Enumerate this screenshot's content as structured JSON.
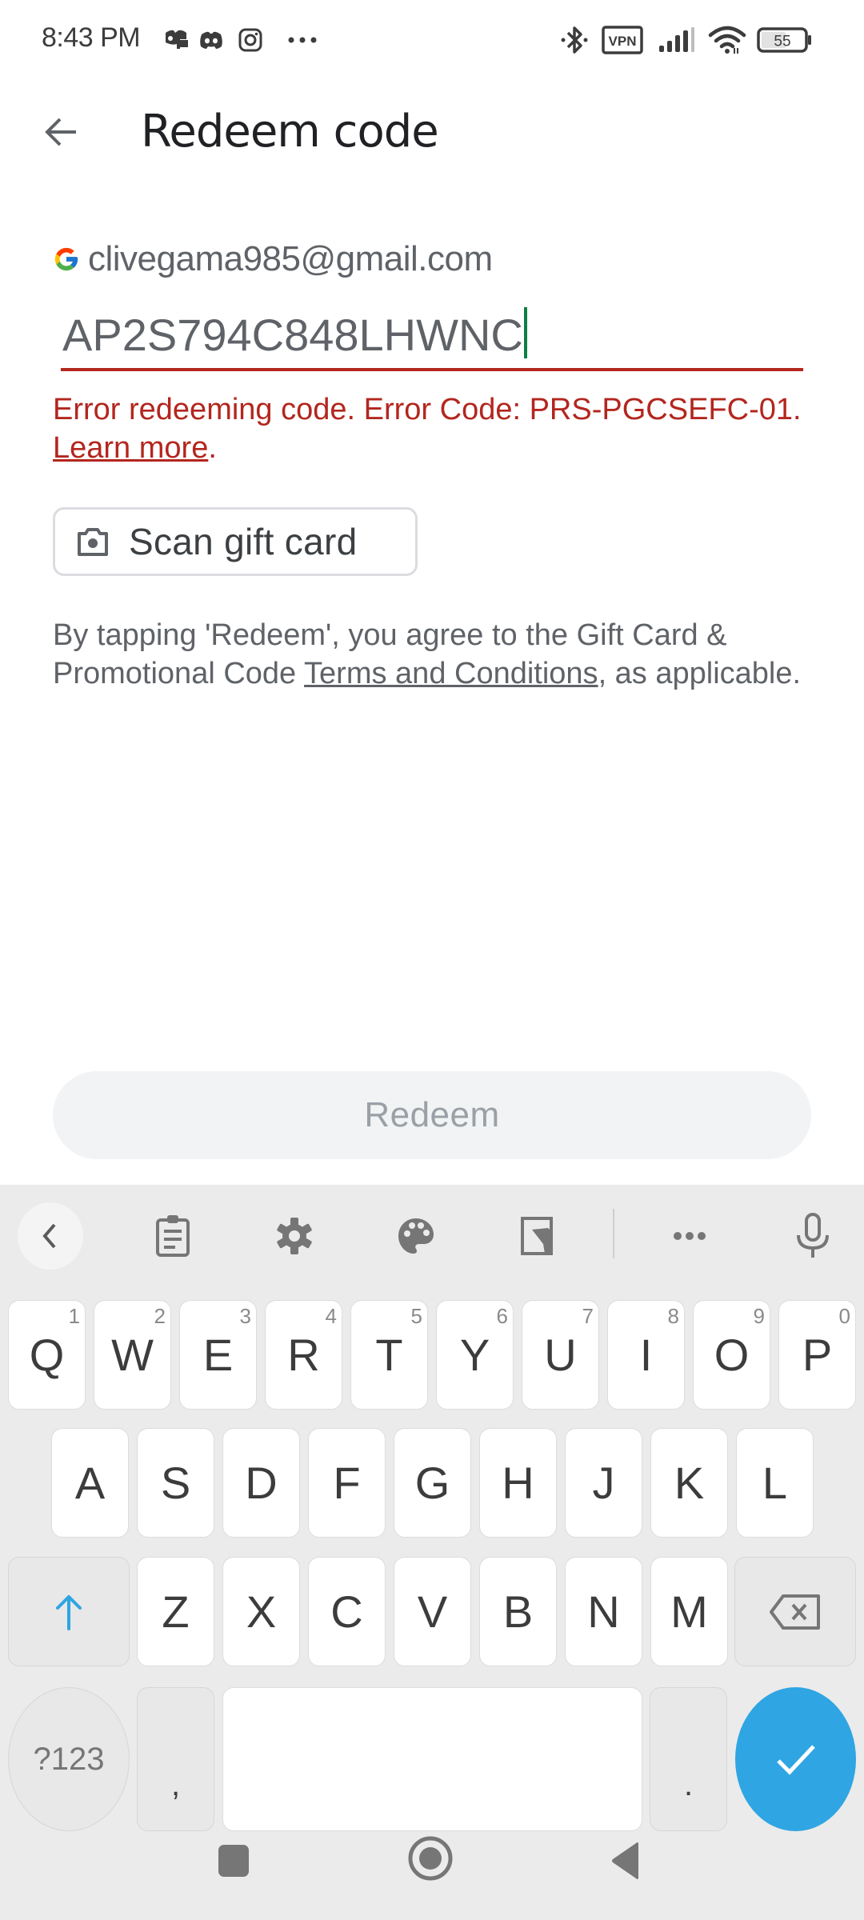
{
  "status_bar": {
    "time": "8:43 PM",
    "left_icons": [
      "discord-chat-icon",
      "discord-icon",
      "instagram-icon",
      "more-notifications-icon"
    ],
    "right_icons": [
      "bluetooth-icon",
      "vpn-icon",
      "signal-icon",
      "wifi-icon",
      "battery-icon"
    ],
    "vpn_label": "VPN",
    "battery_level": "55"
  },
  "app_bar": {
    "back_icon": "arrow-back-icon",
    "title": "Redeem code"
  },
  "account": {
    "icon": "google-logo-icon",
    "email": "clivegama985@gmail.com"
  },
  "code_field": {
    "value": "AP2S794C848LHWNC",
    "error_prefix": "Error redeeming code. Error Code: PRS-PGCSEFC-01. ",
    "error_link": "Learn more",
    "error_suffix": ".",
    "error_color": "#b3261e"
  },
  "scan_button": {
    "icon": "camera-icon",
    "label": "Scan gift card"
  },
  "terms": {
    "prefix": "By tapping 'Redeem', you agree to the Gift Card & Promotional Code ",
    "link": "Terms and Conditions",
    "suffix": ", as applicable."
  },
  "redeem_button": {
    "label": "Redeem",
    "enabled": false
  },
  "keyboard": {
    "toolbar": [
      "collapse-icon",
      "clipboard-icon",
      "settings-icon",
      "theme-palette-icon",
      "one-handed-icon",
      "more-icon",
      "microphone-icon"
    ],
    "row1": [
      {
        "key": "Q",
        "hint": "1"
      },
      {
        "key": "W",
        "hint": "2"
      },
      {
        "key": "E",
        "hint": "3"
      },
      {
        "key": "R",
        "hint": "4"
      },
      {
        "key": "T",
        "hint": "5"
      },
      {
        "key": "Y",
        "hint": "6"
      },
      {
        "key": "U",
        "hint": "7"
      },
      {
        "key": "I",
        "hint": "8"
      },
      {
        "key": "O",
        "hint": "9"
      },
      {
        "key": "P",
        "hint": "0"
      }
    ],
    "row2": [
      "A",
      "S",
      "D",
      "F",
      "G",
      "H",
      "J",
      "K",
      "L"
    ],
    "row3": [
      "Z",
      "X",
      "C",
      "V",
      "B",
      "N",
      "M"
    ],
    "symbols_label": "?123",
    "comma_label": ",",
    "period_label": ".",
    "accent_color": "#2fa5e3"
  },
  "nav_bar": [
    "recents-icon",
    "home-icon",
    "back-icon"
  ]
}
